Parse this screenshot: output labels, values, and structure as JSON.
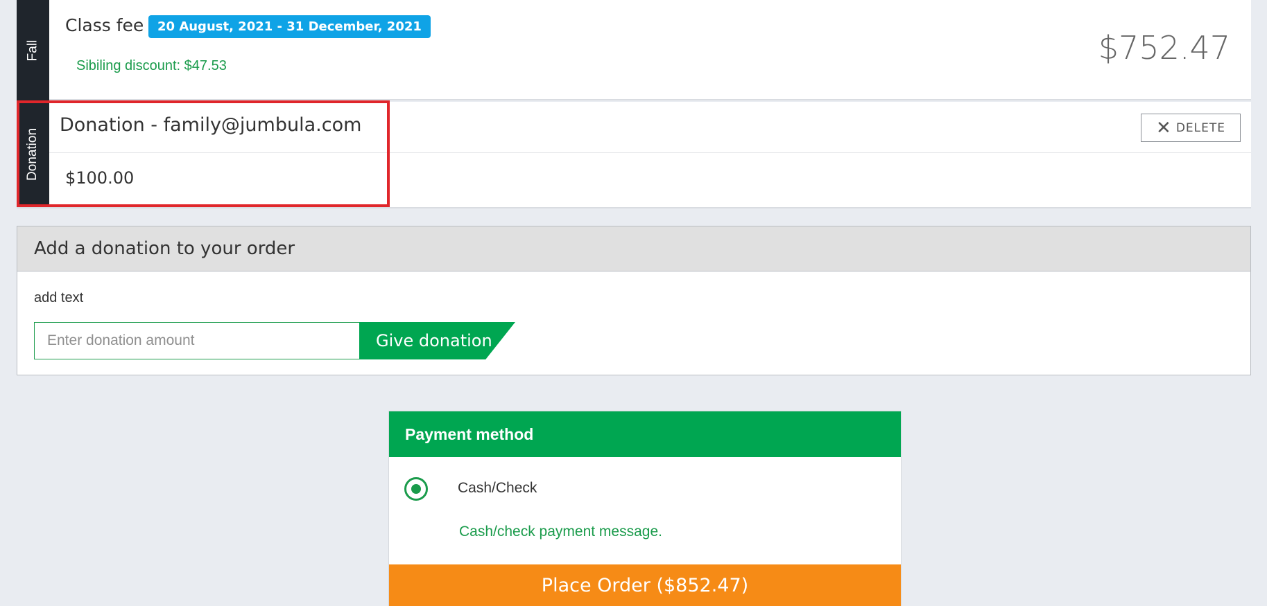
{
  "fall_item": {
    "tab_label": "Fall",
    "title": "Class fee",
    "date_range": "20 August, 2021 - 31 December, 2021",
    "discount": "Sibiling discount: $47.53",
    "amount": "$752.47"
  },
  "donation_item": {
    "tab_label": "Donation",
    "title": "Donation - family@jumbula.com",
    "amount": "$100.00",
    "delete_label": "DELETE",
    "delete_icon": "✕"
  },
  "donation_panel": {
    "header": "Add a donation to your order",
    "description": "add text",
    "input_placeholder": "Enter donation amount",
    "input_value": "",
    "button_label": "Give donation"
  },
  "payment": {
    "header": "Payment method",
    "option_label": "Cash/Check",
    "option_selected": true,
    "message": "Cash/check payment message.",
    "place_order_label": "Place Order ($852.47)"
  },
  "colors": {
    "green": "#00a651",
    "orange": "#f68b16",
    "badge_blue": "#0fa3e6",
    "highlight_red": "#e0262b",
    "tab_dark": "#1f252c"
  }
}
